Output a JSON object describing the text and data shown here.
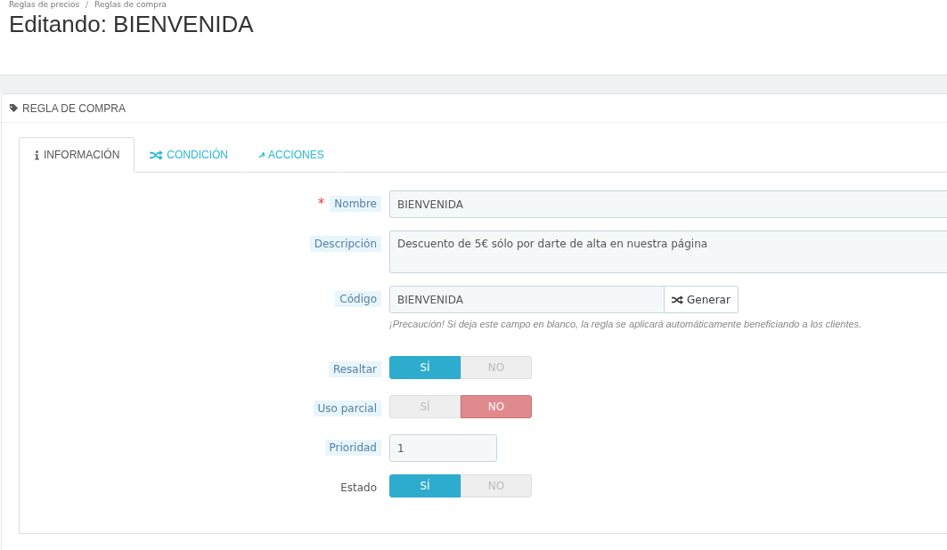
{
  "breadcrumb": [
    "Reglas de precios",
    "Reglas de compra"
  ],
  "page_title": "Editando: BIENVENIDA",
  "panel": {
    "title": "REGLA DE COMPRA"
  },
  "tabs": [
    {
      "label": "INFORMACIÓN",
      "selected": true
    },
    {
      "label": "CONDICIÓN",
      "selected": false
    },
    {
      "label": "ACCIONES",
      "selected": false
    }
  ],
  "fields": [
    {
      "kind": "text",
      "label": "Nombre",
      "required_mark": "*",
      "hint": true,
      "value": "BIENVENIDA"
    },
    {
      "kind": "textarea",
      "label": "Descripción",
      "hint": true,
      "value": "Descuento de 5€ sólo por darte de alta en nuestra página"
    },
    {
      "kind": "code",
      "label": "Código",
      "hint": true,
      "value": "BIENVENIDA",
      "button": "Generar",
      "help": "¡Precaución! Si deja este campo en blanco, la regla se aplicará automáticamente beneficiando a los clientes."
    },
    {
      "kind": "switch",
      "label": "Resaltar",
      "hint": true,
      "options": [
        {
          "label": "SÍ",
          "selected": true
        },
        {
          "label": "NO",
          "selected": false
        }
      ]
    },
    {
      "kind": "switch",
      "label": "Uso parcial",
      "hint": true,
      "options": [
        {
          "label": "SÍ",
          "selected": false
        },
        {
          "label": "NO",
          "selected": true
        }
      ]
    },
    {
      "kind": "short",
      "label": "Prioridad",
      "hint": true,
      "value": "1"
    },
    {
      "kind": "switch",
      "label": "Estado",
      "hint": false,
      "options": [
        {
          "label": "SÍ",
          "selected": true
        },
        {
          "label": "NO",
          "selected": false
        }
      ]
    }
  ]
}
